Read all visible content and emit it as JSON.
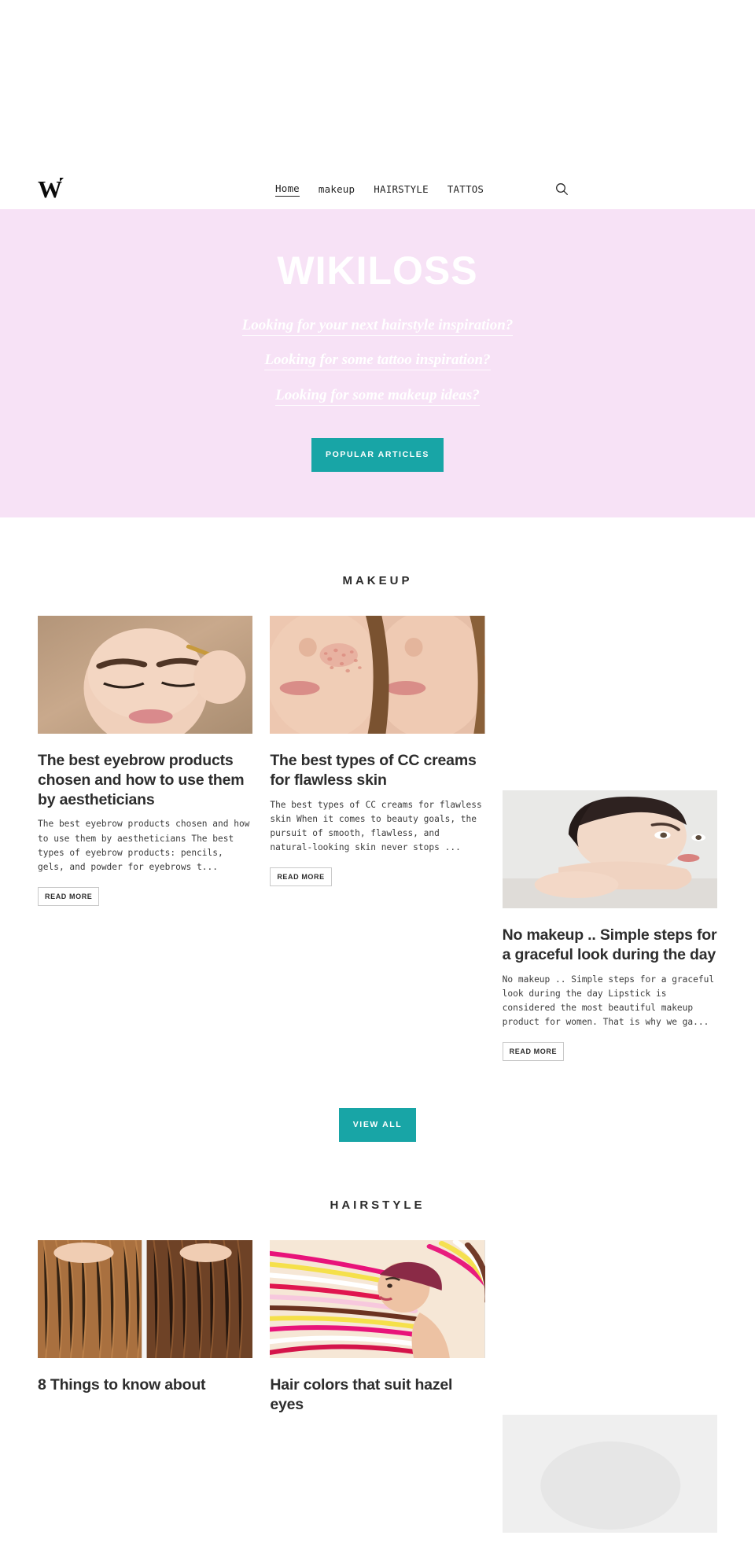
{
  "header": {
    "logo_text": "W",
    "logo_name": "wikiloss-logo",
    "nav": [
      {
        "label": "Home",
        "active": true
      },
      {
        "label": "makeup",
        "active": false
      },
      {
        "label": "HAIRSTYLE",
        "active": false
      },
      {
        "label": "TATTOS",
        "active": false
      }
    ],
    "search_icon": "search-icon"
  },
  "hero": {
    "title": "WIKILOSS",
    "lines": [
      "Looking for your next hairstyle inspiration?",
      "Looking for some tattoo inspiration?",
      "Looking for some makeup ideas?"
    ],
    "cta_label": "POPULAR ARTICLES",
    "bg_color": "#f7e2f6",
    "accent_color": "#18a5a6"
  },
  "sections": [
    {
      "title": "MAKEUP",
      "view_all_label": "VIEW ALL",
      "cards": [
        {
          "title": "The best eyebrow products chosen and how to use them by aestheticians",
          "excerpt": "The best eyebrow products chosen and how to use them by aestheticians The best types of eyebrow products: pencils, gels, and powder for eyebrows t...",
          "read_more_label": "READ MORE",
          "image_name": "eyebrow-makeup-photo"
        },
        {
          "title": "The best types of CC creams for flawless skin",
          "excerpt": "The best types of CC creams for flawless skin When it comes to beauty goals, the pursuit of smooth, flawless, and natural-looking skin never stops ...",
          "read_more_label": "READ MORE",
          "image_name": "cc-cream-skin-photo"
        },
        {
          "title": "No makeup .. Simple steps for a graceful look during the day",
          "excerpt": "No makeup .. Simple steps for a graceful look during the day Lipstick is considered the most beautiful makeup product for women. That is why we ga...",
          "read_more_label": "READ MORE",
          "image_name": "no-makeup-model-photo"
        }
      ]
    },
    {
      "title": "HAIRSTYLE",
      "cards": [
        {
          "title": "8 Things to know about",
          "image_name": "hair-extensions-photo"
        },
        {
          "title": "Hair colors that suit hazel eyes",
          "image_name": "colorful-hair-photo"
        },
        {
          "title": "",
          "image_name": "hairstyle-third-photo"
        }
      ]
    }
  ]
}
